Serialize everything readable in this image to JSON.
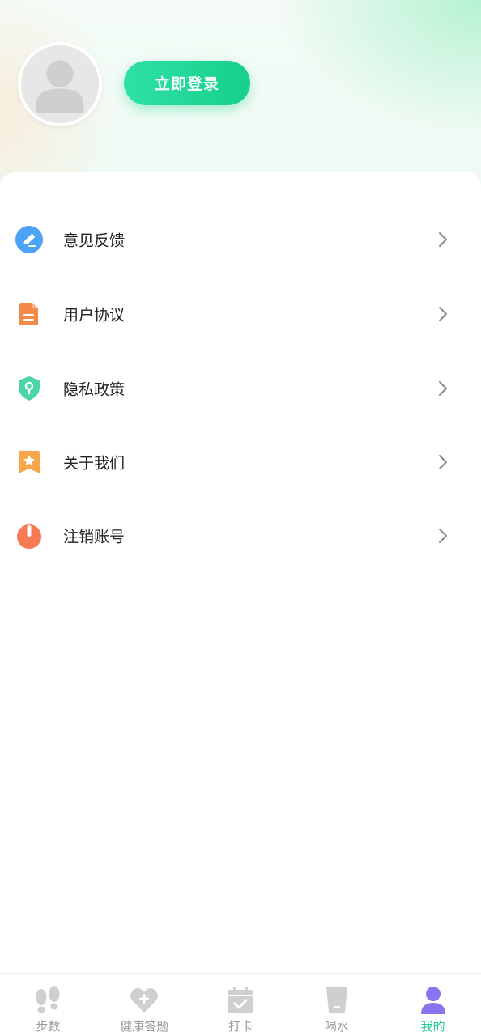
{
  "header": {
    "login_button_label": "立即登录",
    "avatar_icon": "default-user-avatar",
    "accent_color": "#1ed28c"
  },
  "menu": {
    "items": [
      {
        "label": "意见反馈",
        "icon": "edit-pencil-icon",
        "color": "#4aa3f5"
      },
      {
        "label": "用户协议",
        "icon": "document-icon",
        "color": "#f5894a"
      },
      {
        "label": "隐私政策",
        "icon": "shield-key-icon",
        "color": "#4ad6a6"
      },
      {
        "label": "关于我们",
        "icon": "star-bookmark-icon",
        "color": "#f7a64a"
      },
      {
        "label": "注销账号",
        "icon": "power-icon",
        "color": "#f57a55"
      }
    ]
  },
  "tabbar": {
    "tabs": [
      {
        "label": "步数",
        "icon": "footprints-icon"
      },
      {
        "label": "健康答题",
        "icon": "heart-plus-icon"
      },
      {
        "label": "打卡",
        "icon": "calendar-check-icon"
      },
      {
        "label": "喝水",
        "icon": "water-cup-icon"
      },
      {
        "label": "我的",
        "icon": "user-profile-icon"
      }
    ],
    "active_index": 4,
    "active_label_color": "#1fc98a",
    "active_icon_color": "#8a74f0",
    "inactive_color": "#cfcfcf"
  }
}
